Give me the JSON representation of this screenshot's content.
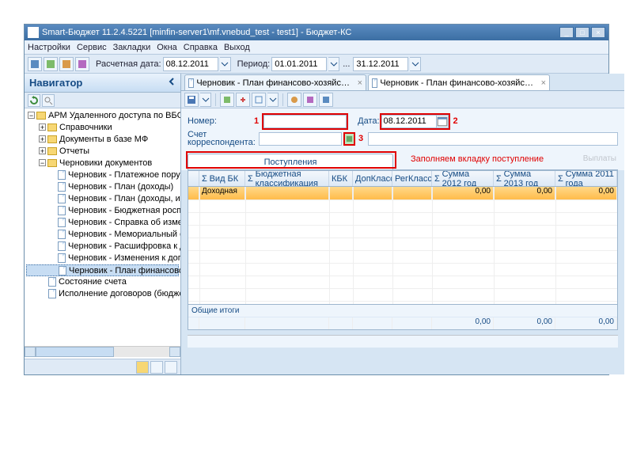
{
  "title": "Smart-Бюджет 11.2.4.5221 [minfin-server1\\mf.vnebud_test - test1] - Бюджет-КС",
  "menu": [
    "Настройки",
    "Сервис",
    "Закладки",
    "Окна",
    "Справка",
    "Выход"
  ],
  "toolbar": {
    "rdate_label": "Расчетная дата:",
    "rdate": "08.12.2011",
    "period_label": "Период:",
    "period_from": "01.01.2011",
    "period_to": "31.12.2011",
    "sep": "..."
  },
  "nav": {
    "title": "Навигатор",
    "tree": {
      "root": "АРМ Удаленного доступа по ВБС",
      "n1": "Справочники",
      "n2": "Документы в базе МФ",
      "n3": "Отчеты",
      "n4": "Черновики документов",
      "c1": "Черновик - Платежное поручение (расхо",
      "c2": "Черновик - План (доходы)",
      "c3": "Черновик - План (доходы, изменения)",
      "c4": "Черновик - Бюджетная роспись (расходы",
      "c5": "Черновик - Справка об изменении бюдж",
      "c6": "Черновик - Мемориальный ордер",
      "c7": "Черновик - Расшифровка к договорам (Б",
      "c8": "Черновик - Изменения к договорам (Бю",
      "c9": "Черновик - План финансово-хозяйствен",
      "n5": "Состояние счета",
      "n6": "Исполнение договоров (бюджетные обязат"
    }
  },
  "tabs": {
    "t1": "Черновик - План финансово-хозяйственной деятельности",
    "t2": "Черновик - План финансово-хозяйственной деятельности"
  },
  "form": {
    "num_label": "Номер:",
    "date_label": "Дата:",
    "date_value": "08.12.2011",
    "acct_label": "Счет корреспондента:",
    "annot1": "1",
    "annot2": "2",
    "annot3": "3"
  },
  "subtab": {
    "label": "Поступления",
    "annot": "Заполняем вкладку поступление",
    "faded": "Выплаты"
  },
  "grid": {
    "cols": [
      "Вид БК",
      "Бюджетная классификация",
      "КБК",
      "ДопКласс",
      "РегКласс",
      "Сумма 2012 год",
      "Сумма 2013 год",
      "Сумма 2011 года"
    ],
    "row0": {
      "vid": "Доходная",
      "s12": "0,00",
      "s13": "0,00",
      "s11": "0,00"
    },
    "footer_label": "Общие итоги",
    "footer": {
      "s12": "0,00",
      "s13": "0,00",
      "s11": "0,00"
    }
  },
  "chart_data": {
    "type": "table",
    "title": "Поступления",
    "columns": [
      "Вид БК",
      "Бюджетная классификация",
      "КБК",
      "ДопКласс",
      "РегКласс",
      "Сумма 2012 год",
      "Сумма 2013 год",
      "Сумма 2011 года"
    ],
    "rows": [
      {
        "Вид БК": "Доходная",
        "Бюджетная классификация": "",
        "КБК": "",
        "ДопКласс": "",
        "РегКласс": "",
        "Сумма 2012 год": 0.0,
        "Сумма 2013 год": 0.0,
        "Сумма 2011 года": 0.0
      }
    ],
    "totals": {
      "Сумма 2012 год": 0.0,
      "Сумма 2013 год": 0.0,
      "Сумма 2011 года": 0.0
    }
  }
}
